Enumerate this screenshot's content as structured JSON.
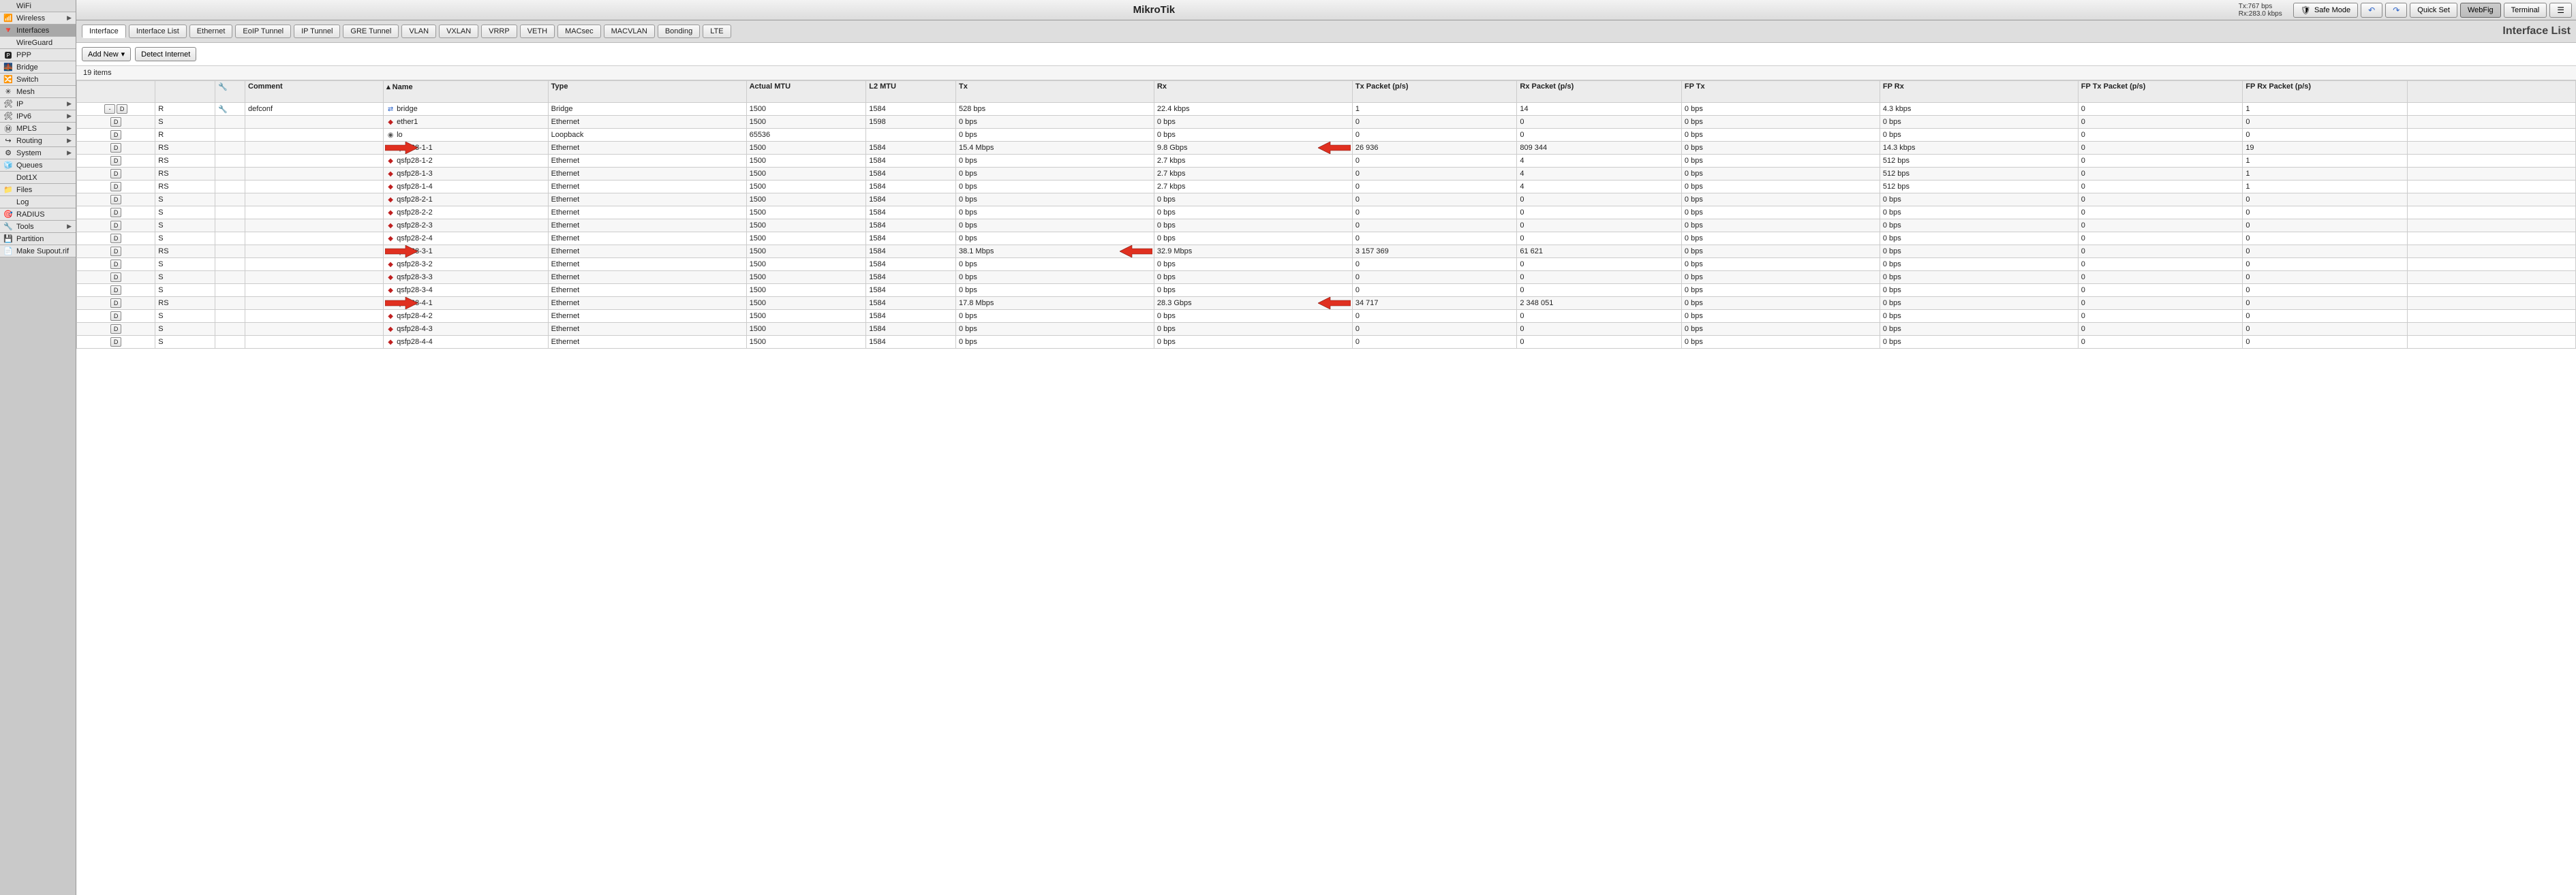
{
  "brand": "MikroTik",
  "rates": {
    "tx": "Tx:767 bps",
    "rx": "Rx:283.0 kbps"
  },
  "top_buttons": {
    "safe_mode": "Safe Mode",
    "quick_set": "Quick Set",
    "webfig": "WebFig",
    "terminal": "Terminal"
  },
  "page_heading": "Interface List",
  "sidebar": [
    {
      "label": "WiFi",
      "icon": "",
      "sub": false
    },
    {
      "label": "Wireless",
      "icon": "📶",
      "sub": true
    },
    {
      "label": "Interfaces",
      "icon": "🔻",
      "sub": false,
      "active": true
    },
    {
      "label": "WireGuard",
      "icon": "",
      "sub": false
    },
    {
      "label": "PPP",
      "icon": "🅿",
      "sub": false
    },
    {
      "label": "Bridge",
      "icon": "🌉",
      "sub": false
    },
    {
      "label": "Switch",
      "icon": "🔀",
      "sub": false
    },
    {
      "label": "Mesh",
      "icon": "✳",
      "sub": false
    },
    {
      "label": "IP",
      "icon": "🛠",
      "sub": true
    },
    {
      "label": "IPv6",
      "icon": "🛠",
      "sub": true
    },
    {
      "label": "MPLS",
      "icon": "Ⓜ",
      "sub": true
    },
    {
      "label": "Routing",
      "icon": "↪",
      "sub": true
    },
    {
      "label": "System",
      "icon": "⚙",
      "sub": true
    },
    {
      "label": "Queues",
      "icon": "🧊",
      "sub": false
    },
    {
      "label": "Dot1X",
      "icon": "",
      "sub": false
    },
    {
      "label": "Files",
      "icon": "📁",
      "sub": false
    },
    {
      "label": "Log",
      "icon": "",
      "sub": false
    },
    {
      "label": "RADIUS",
      "icon": "🎯",
      "sub": false
    },
    {
      "label": "Tools",
      "icon": "🔧",
      "sub": true
    },
    {
      "label": "Partition",
      "icon": "💾",
      "sub": false
    },
    {
      "label": "Make Supout.rif",
      "icon": "📄",
      "sub": false
    }
  ],
  "subtabs": [
    "Interface",
    "Interface List",
    "Ethernet",
    "EoIP Tunnel",
    "IP Tunnel",
    "GRE Tunnel",
    "VLAN",
    "VXLAN",
    "VRRP",
    "VETH",
    "MACsec",
    "MACVLAN",
    "Bonding",
    "LTE"
  ],
  "subtab_active": 0,
  "toolbar": {
    "add_new": "Add New",
    "detect": "Detect Internet"
  },
  "item_count": "19 items",
  "columns": [
    "",
    "",
    "",
    "Comment",
    "Name",
    "Type",
    "Actual MTU",
    "L2 MTU",
    "Tx",
    "Rx",
    "Tx Packet (p/s)",
    "Rx Packet (p/s)",
    "FP Tx",
    "FP Rx",
    "FP Tx Packet (p/s)",
    "FP Rx Packet (p/s)",
    ""
  ],
  "sort_col": 4,
  "rows": [
    {
      "btns": [
        "-",
        "D"
      ],
      "flag": "R",
      "cfg": true,
      "comment": "defconf",
      "icon": "br",
      "name": "bridge",
      "type": "Bridge",
      "amtu": "1500",
      "l2": "1584",
      "tx": "528 bps",
      "rx": "22.4 kbps",
      "txp": "1",
      "rxp": "14",
      "fptx": "0 bps",
      "fprx": "4.3 kbps",
      "fptxp": "0",
      "fprxp": "1"
    },
    {
      "btns": [
        "D"
      ],
      "flag": "S",
      "cfg": false,
      "comment": "",
      "icon": "eth",
      "name": "ether1",
      "type": "Ethernet",
      "amtu": "1500",
      "l2": "1598",
      "tx": "0 bps",
      "rx": "0 bps",
      "txp": "0",
      "rxp": "0",
      "fptx": "0 bps",
      "fprx": "0 bps",
      "fptxp": "0",
      "fprxp": "0"
    },
    {
      "btns": [
        "D"
      ],
      "flag": "R",
      "cfg": false,
      "comment": "",
      "icon": "lo",
      "name": "lo",
      "type": "Loopback",
      "amtu": "65536",
      "l2": "",
      "tx": "0 bps",
      "rx": "0 bps",
      "txp": "0",
      "rxp": "0",
      "fptx": "0 bps",
      "fprx": "0 bps",
      "fptxp": "0",
      "fprxp": "0"
    },
    {
      "btns": [
        "D"
      ],
      "flag": "RS",
      "cfg": false,
      "comment": "",
      "icon": "eth",
      "name": "qsfp28-1-1",
      "type": "Ethernet",
      "amtu": "1500",
      "l2": "1584",
      "tx": "15.4 Mbps",
      "rx": "9.8 Gbps",
      "txp": "26 936",
      "rxp": "809 344",
      "fptx": "0 bps",
      "fprx": "14.3 kbps",
      "fptxp": "0",
      "fprxp": "19",
      "arrow_name": true,
      "arrow_rx": true
    },
    {
      "btns": [
        "D"
      ],
      "flag": "RS",
      "cfg": false,
      "comment": "",
      "icon": "eth",
      "name": "qsfp28-1-2",
      "type": "Ethernet",
      "amtu": "1500",
      "l2": "1584",
      "tx": "0 bps",
      "rx": "2.7 kbps",
      "txp": "0",
      "rxp": "4",
      "fptx": "0 bps",
      "fprx": "512 bps",
      "fptxp": "0",
      "fprxp": "1"
    },
    {
      "btns": [
        "D"
      ],
      "flag": "RS",
      "cfg": false,
      "comment": "",
      "icon": "eth",
      "name": "qsfp28-1-3",
      "type": "Ethernet",
      "amtu": "1500",
      "l2": "1584",
      "tx": "0 bps",
      "rx": "2.7 kbps",
      "txp": "0",
      "rxp": "4",
      "fptx": "0 bps",
      "fprx": "512 bps",
      "fptxp": "0",
      "fprxp": "1"
    },
    {
      "btns": [
        "D"
      ],
      "flag": "RS",
      "cfg": false,
      "comment": "",
      "icon": "eth",
      "name": "qsfp28-1-4",
      "type": "Ethernet",
      "amtu": "1500",
      "l2": "1584",
      "tx": "0 bps",
      "rx": "2.7 kbps",
      "txp": "0",
      "rxp": "4",
      "fptx": "0 bps",
      "fprx": "512 bps",
      "fptxp": "0",
      "fprxp": "1"
    },
    {
      "btns": [
        "D"
      ],
      "flag": "S",
      "cfg": false,
      "comment": "",
      "icon": "eth",
      "name": "qsfp28-2-1",
      "type": "Ethernet",
      "amtu": "1500",
      "l2": "1584",
      "tx": "0 bps",
      "rx": "0 bps",
      "txp": "0",
      "rxp": "0",
      "fptx": "0 bps",
      "fprx": "0 bps",
      "fptxp": "0",
      "fprxp": "0"
    },
    {
      "btns": [
        "D"
      ],
      "flag": "S",
      "cfg": false,
      "comment": "",
      "icon": "eth",
      "name": "qsfp28-2-2",
      "type": "Ethernet",
      "amtu": "1500",
      "l2": "1584",
      "tx": "0 bps",
      "rx": "0 bps",
      "txp": "0",
      "rxp": "0",
      "fptx": "0 bps",
      "fprx": "0 bps",
      "fptxp": "0",
      "fprxp": "0"
    },
    {
      "btns": [
        "D"
      ],
      "flag": "S",
      "cfg": false,
      "comment": "",
      "icon": "eth",
      "name": "qsfp28-2-3",
      "type": "Ethernet",
      "amtu": "1500",
      "l2": "1584",
      "tx": "0 bps",
      "rx": "0 bps",
      "txp": "0",
      "rxp": "0",
      "fptx": "0 bps",
      "fprx": "0 bps",
      "fptxp": "0",
      "fprxp": "0"
    },
    {
      "btns": [
        "D"
      ],
      "flag": "S",
      "cfg": false,
      "comment": "",
      "icon": "eth",
      "name": "qsfp28-2-4",
      "type": "Ethernet",
      "amtu": "1500",
      "l2": "1584",
      "tx": "0 bps",
      "rx": "0 bps",
      "txp": "0",
      "rxp": "0",
      "fptx": "0 bps",
      "fprx": "0 bps",
      "fptxp": "0",
      "fprxp": "0"
    },
    {
      "btns": [
        "D"
      ],
      "flag": "RS",
      "cfg": false,
      "comment": "",
      "icon": "eth",
      "name": "qsfp28-3-1",
      "type": "Ethernet",
      "amtu": "1500",
      "l2": "1584",
      "tx": "38.1 Mbps",
      "rx": "32.9 Mbps",
      "txp": "3 157 369",
      "rxp": "61 621",
      "fptx": "0 bps",
      "fprx": "0 bps",
      "fptxp": "0",
      "fprxp": "0",
      "arrow_name": true,
      "arrow_tx": true
    },
    {
      "btns": [
        "D"
      ],
      "flag": "S",
      "cfg": false,
      "comment": "",
      "icon": "eth",
      "name": "qsfp28-3-2",
      "type": "Ethernet",
      "amtu": "1500",
      "l2": "1584",
      "tx": "0 bps",
      "rx": "0 bps",
      "txp": "0",
      "rxp": "0",
      "fptx": "0 bps",
      "fprx": "0 bps",
      "fptxp": "0",
      "fprxp": "0"
    },
    {
      "btns": [
        "D"
      ],
      "flag": "S",
      "cfg": false,
      "comment": "",
      "icon": "eth",
      "name": "qsfp28-3-3",
      "type": "Ethernet",
      "amtu": "1500",
      "l2": "1584",
      "tx": "0 bps",
      "rx": "0 bps",
      "txp": "0",
      "rxp": "0",
      "fptx": "0 bps",
      "fprx": "0 bps",
      "fptxp": "0",
      "fprxp": "0"
    },
    {
      "btns": [
        "D"
      ],
      "flag": "S",
      "cfg": false,
      "comment": "",
      "icon": "eth",
      "name": "qsfp28-3-4",
      "type": "Ethernet",
      "amtu": "1500",
      "l2": "1584",
      "tx": "0 bps",
      "rx": "0 bps",
      "txp": "0",
      "rxp": "0",
      "fptx": "0 bps",
      "fprx": "0 bps",
      "fptxp": "0",
      "fprxp": "0"
    },
    {
      "btns": [
        "D"
      ],
      "flag": "RS",
      "cfg": false,
      "comment": "",
      "icon": "eth",
      "name": "qsfp28-4-1",
      "type": "Ethernet",
      "amtu": "1500",
      "l2": "1584",
      "tx": "17.8 Mbps",
      "rx": "28.3 Gbps",
      "txp": "34 717",
      "rxp": "2 348 051",
      "fptx": "0 bps",
      "fprx": "0 bps",
      "fptxp": "0",
      "fprxp": "0",
      "arrow_name": true,
      "arrow_rx": true
    },
    {
      "btns": [
        "D"
      ],
      "flag": "S",
      "cfg": false,
      "comment": "",
      "icon": "eth",
      "name": "qsfp28-4-2",
      "type": "Ethernet",
      "amtu": "1500",
      "l2": "1584",
      "tx": "0 bps",
      "rx": "0 bps",
      "txp": "0",
      "rxp": "0",
      "fptx": "0 bps",
      "fprx": "0 bps",
      "fptxp": "0",
      "fprxp": "0"
    },
    {
      "btns": [
        "D"
      ],
      "flag": "S",
      "cfg": false,
      "comment": "",
      "icon": "eth",
      "name": "qsfp28-4-3",
      "type": "Ethernet",
      "amtu": "1500",
      "l2": "1584",
      "tx": "0 bps",
      "rx": "0 bps",
      "txp": "0",
      "rxp": "0",
      "fptx": "0 bps",
      "fprx": "0 bps",
      "fptxp": "0",
      "fprxp": "0"
    },
    {
      "btns": [
        "D"
      ],
      "flag": "S",
      "cfg": false,
      "comment": "",
      "icon": "eth",
      "name": "qsfp28-4-4",
      "type": "Ethernet",
      "amtu": "1500",
      "l2": "1584",
      "tx": "0 bps",
      "rx": "0 bps",
      "txp": "0",
      "rxp": "0",
      "fptx": "0 bps",
      "fprx": "0 bps",
      "fptxp": "0",
      "fprxp": "0"
    }
  ]
}
